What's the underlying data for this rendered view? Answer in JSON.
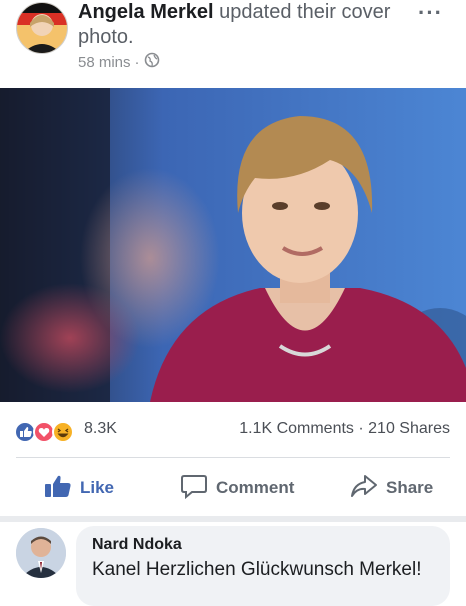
{
  "post": {
    "author": "Angela Merkel",
    "action_text": "updated their cover photo.",
    "time": "58 mins",
    "time_separator": "·",
    "privacy_icon": "globe-icon",
    "more_label": "···"
  },
  "reactions": {
    "icons": [
      "like-reaction-icon",
      "love-reaction-icon",
      "haha-reaction-icon"
    ],
    "count": "8.3K",
    "comments": "1.1K Comments",
    "separator": "·",
    "shares": "210 Shares"
  },
  "actions": {
    "like_label": "Like",
    "comment_label": "Comment",
    "share_label": "Share"
  },
  "comment": {
    "author": "Nard Ndoka",
    "text": "Kanel Herzlichen Glückwunsch Merkel!"
  },
  "colors": {
    "facebook_blue": "#4267b2",
    "love_red": "#f25268",
    "haha_yellow": "#f7b125",
    "bubble_gray": "#f0f2f5"
  }
}
